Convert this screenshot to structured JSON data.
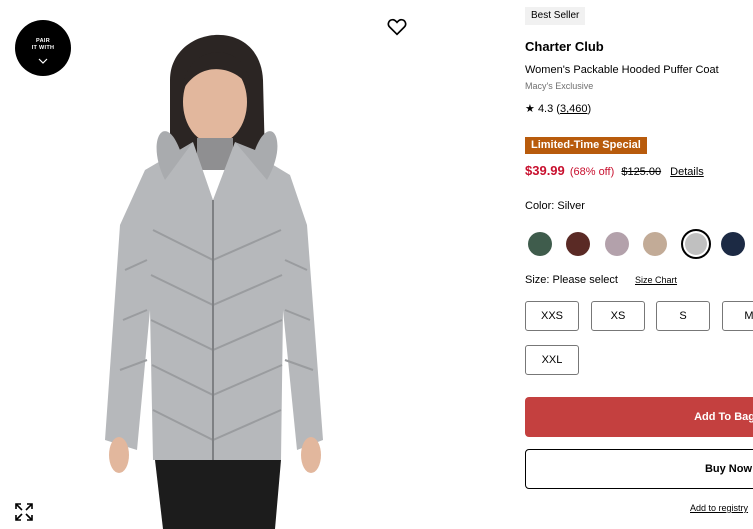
{
  "image": {
    "pair_badge": {
      "line1": "PAIR",
      "line2": "IT WITH"
    },
    "icons": {
      "favorite": "heart-icon",
      "expand": "expand-icon",
      "pair": "chevron-down-icon"
    }
  },
  "product": {
    "badge": "Best Seller",
    "brand": "Charter Club",
    "name": "Women's Packable Hooded Puffer Coat",
    "exclusive": "Macy's Exclusive",
    "rating": {
      "star": "★",
      "value": "4.3",
      "open": "(",
      "count": "3,460",
      "close": ")"
    },
    "promo": "Limited-Time Special",
    "price": "$39.99",
    "discount": "(68% off)",
    "original_price": "$125.00",
    "details_link": "Details",
    "accent_color": "#c8102e"
  },
  "color": {
    "label": "Color: Silver",
    "swatches": [
      {
        "name": "green",
        "hex": "#3f5c4c"
      },
      {
        "name": "brown",
        "hex": "#5a2a25"
      },
      {
        "name": "mauve",
        "hex": "#b3a1ab"
      },
      {
        "name": "taupe",
        "hex": "#c2ab97"
      },
      {
        "name": "silver",
        "hex": "#c0c0c0",
        "selected": true
      },
      {
        "name": "navy",
        "hex": "#1c2a44"
      }
    ]
  },
  "size": {
    "label": "Size: Please select",
    "chart_link": "Size Chart",
    "options": [
      "XXS",
      "XS",
      "S",
      "M",
      "XXL"
    ]
  },
  "actions": {
    "add_to_bag": "Add To Bag",
    "buy_now": "Buy Now",
    "registry": "Add to registry"
  }
}
